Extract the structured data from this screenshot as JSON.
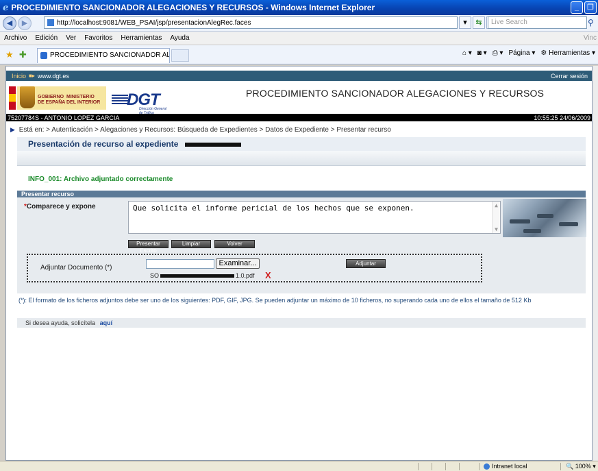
{
  "window": {
    "title": "PROCEDIMIENTO SANCIONADOR ALEGACIONES Y RECURSOS - Windows Internet Explorer",
    "minimize": "_",
    "maximize": "❐"
  },
  "browser": {
    "url": "http://localhost:9081/WEB_PSAI/jsp/presentacionAlegRec.faces",
    "search_placeholder": "Live Search",
    "menu": [
      "Archivo",
      "Edición",
      "Ver",
      "Favoritos",
      "Herramientas",
      "Ayuda"
    ],
    "menu_right": "Vinc",
    "tab_title": "PROCEDIMIENTO SANCIONADOR ALEGACIONES Y R...",
    "cmd_pagina": "Página",
    "cmd_herramientas": "Herramientas"
  },
  "site": {
    "inicio": "Inicio",
    "domain": "www.dgt.es",
    "cerrar_sesion": "Cerrar sesión",
    "gobierno": "GOBIERNO\nDE ESPAÑA",
    "ministerio": "MINISTERIO\nDEL INTERIOR",
    "dgt": "DGT",
    "dgt_sub": "Dirección General\nde Tráfico",
    "page_title": "PROCEDIMIENTO SANCIONADOR ALEGACIONES Y RECURSOS",
    "user": "75207784S  -  ANTONIO LOPEZ GARCIA",
    "datetime": "10:55:25 24/06/2009"
  },
  "breadcrumb": "Está en:  > Autenticación  > Alegaciones y Recursos: Búsqueda de Expedientes  > Datos de Expediente  > Presentar recurso",
  "main": {
    "heading": "Presentación de recurso al expediente",
    "info_message": "INFO_001: Archivo adjuntado correctamente",
    "section_title": "Presentar recurso",
    "comparece_label": "Comparece y expone",
    "required_mark": "*",
    "comparece_value": "Que solicita el informe pericial de los hechos que se exponen.",
    "buttons": {
      "presentar": "Presentar Escrito",
      "limpiar": "Limpiar",
      "volver": "Volver"
    },
    "attach_label": "Adjuntar Documento (*)",
    "browse": "Examinar...",
    "adjuntar": "Adjuntar",
    "file_prefix": "SO",
    "file_suffix": "1.0.pdf",
    "delete_mark": "X",
    "footnote": "(*): El formato de los ficheros adjuntos debe ser uno de los siguientes: PDF, GIF, JPG. Se pueden adjuntar un máximo de 10 ficheros, no superando cada uno de ellos el tamaño de 512 Kb",
    "help_text": "Si desea ayuda, solicítela",
    "help_link": "aquí"
  },
  "status": {
    "zone": "Intranet local",
    "zoom": "100%"
  },
  "colors": {
    "info_green": "#1a8a2a",
    "section_blue": "#5c7a97",
    "dgt_navy": "#1a3a8c"
  }
}
